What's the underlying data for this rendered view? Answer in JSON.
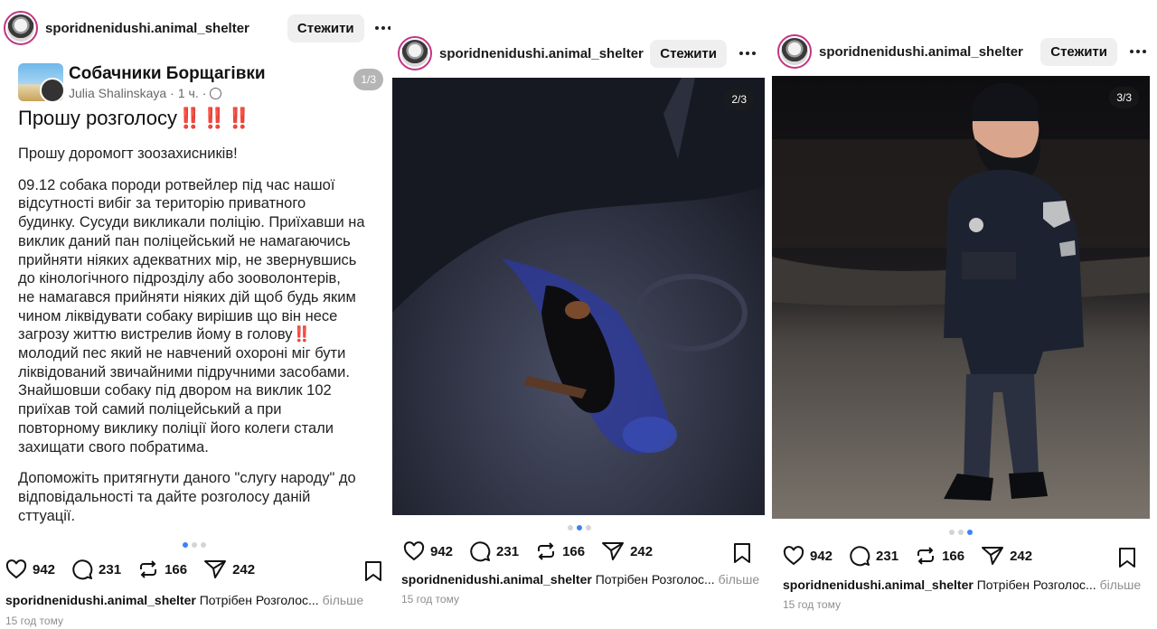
{
  "account": {
    "username": "sporidnenidushi.animal_shelter",
    "follow_label": "Стежити"
  },
  "stats": {
    "likes": "942",
    "comments": "231",
    "reposts": "166",
    "shares": "242"
  },
  "caption": {
    "text": "Потрібен Розголос...",
    "more": "більше",
    "time": "15 год тому"
  },
  "panel1": {
    "counter": "1/3",
    "group_name": "Собачники Борщагівки",
    "author": "Julia Shalinskaya",
    "author_time": "1 ч.",
    "title": "Прошу розголосу",
    "title_marks": "‼️‼️‼️",
    "para1": "Прошу доромогт зоозахисників!",
    "para2a": "09.12 собака породи ротвейлер під час нашої\nвідсутності вибіг за територію приватного\nбудинку. Сусуди викликали поліцію. Приїхавши на\nвиклик даний пан поліцейський не намагаючись\nприйняти ніяких адекватних мір, не звернувшись\nдо кінологічного підрозділу або зооволонтерів,\nне намагався прийняти  ніяких дій щоб будь яким\nчином ліквідувати собаку вирішив що він несе\nзагрозу життю вистрелив йому в голову",
    "para2_mark": "‼️",
    "para2b": "\nмолодий пес який не навчений охороні міг бути\nліквідований звичайними підручними засобами.\nЗнайшовши собаку під двором на виклик 102\nприїхав той самий поліцейський а при\nповторному виклику поліції його колеги стали\nзахищати свого побратима.",
    "para3": "Допоможіть притягнути даного \"слугу народу\" до\nвідповідальності та дайте розголосу даній\nсттуації."
  },
  "panel2": {
    "counter": "2/3"
  },
  "panel3": {
    "counter": "3/3"
  },
  "colors": {
    "accent_dot": "#3b82f6",
    "alert_red": "#e0202a",
    "muted": "#8e8e8e"
  },
  "icons": [
    "heart-icon",
    "comment-icon",
    "repost-icon",
    "share-icon",
    "bookmark-icon",
    "more-icon",
    "globe-icon"
  ]
}
